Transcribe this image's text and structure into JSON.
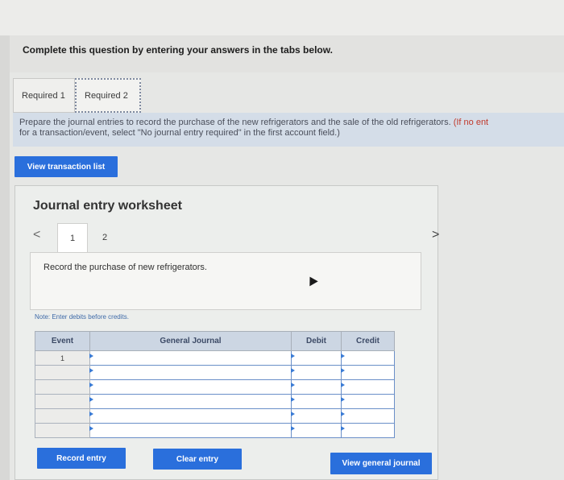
{
  "header": {
    "title": "Complete this question by entering your answers in the tabs below."
  },
  "tabs": [
    {
      "label": "Required 1"
    },
    {
      "label": "Required 2"
    }
  ],
  "instruction": {
    "text": "Prepare the journal entries to record the purchase of the new refrigerators and the sale of the old refrigerators.",
    "paren_text": "(If no ent",
    "line2": "for a transaction/event, select \"No journal entry required\" in the first account field.)"
  },
  "buttons": {
    "view_transaction_list": "View transaction list",
    "record_entry": "Record entry",
    "clear_entry": "Clear entry",
    "view_general_journal": "View general journal"
  },
  "worksheet": {
    "title": "Journal entry worksheet",
    "nav_prev": "<",
    "nav_next": ">",
    "pages": [
      "1",
      "2"
    ],
    "record_text": "Record the purchase of new refrigerators.",
    "note": "Note: Enter debits before credits."
  },
  "journal": {
    "columns": [
      "Event",
      "General Journal",
      "Debit",
      "Credit"
    ],
    "rows": [
      {
        "event": "1",
        "account": "",
        "debit": "",
        "credit": ""
      },
      {
        "event": "",
        "account": "",
        "debit": "",
        "credit": ""
      },
      {
        "event": "",
        "account": "",
        "debit": "",
        "credit": ""
      },
      {
        "event": "",
        "account": "",
        "debit": "",
        "credit": ""
      },
      {
        "event": "",
        "account": "",
        "debit": "",
        "credit": ""
      },
      {
        "event": "",
        "account": "",
        "debit": "",
        "credit": ""
      }
    ]
  },
  "colors": {
    "accent_blue": "#2a6fdc",
    "instruction_bg": "#d4dde8",
    "header_bg": "#ccd6e3"
  }
}
